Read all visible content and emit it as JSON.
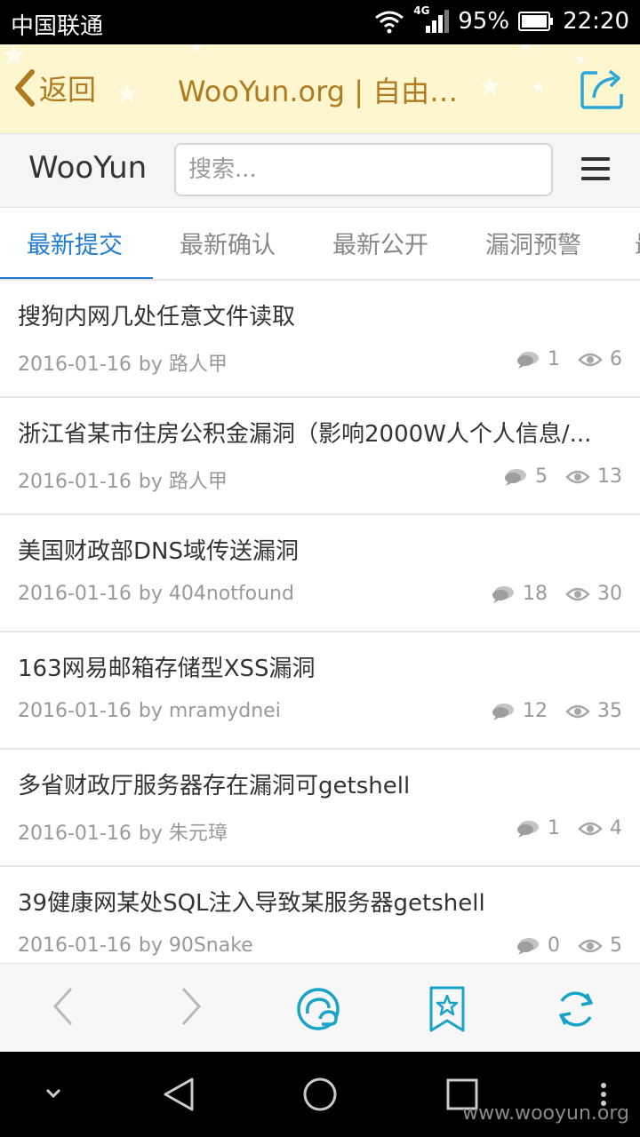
{
  "status_bar": {
    "carrier": "中国联通",
    "network": "4G",
    "battery": "95%",
    "time": "22:20"
  },
  "browser": {
    "back_label": "返回",
    "page_title": "WooYun.org | 自由平台",
    "share_icon": "share-icon"
  },
  "site_header": {
    "brand": "WooYun",
    "search_placeholder": "搜索...",
    "menu_icon": "hamburger-menu-icon"
  },
  "tabs": [
    {
      "label": "最新提交",
      "active": true
    },
    {
      "label": "最新确认",
      "active": false
    },
    {
      "label": "最新公开",
      "active": false
    },
    {
      "label": "漏洞预警",
      "active": false
    }
  ],
  "items": [
    {
      "title": "搜狗内网几处任意文件读取",
      "date": "2016-01-16",
      "author": "by 路人甲",
      "comments": "1",
      "views": "6"
    },
    {
      "title": "浙江省某市住房公积金漏洞（影响2000W人个人信息/...",
      "date": "2016-01-16",
      "author": "by 路人甲",
      "comments": "5",
      "views": "13"
    },
    {
      "title": "美国财政部DNS域传送漏洞",
      "date": "2016-01-16",
      "author": "by 404notfound",
      "comments": "18",
      "views": "30"
    },
    {
      "title": "163网易邮箱存储型XSS漏洞",
      "date": "2016-01-16",
      "author": "by mramydnei",
      "comments": "12",
      "views": "35"
    },
    {
      "title": "多省财政厅服务器存在漏洞可getshell",
      "date": "2016-01-16",
      "author": "by 朱元璋",
      "comments": "1",
      "views": "4"
    },
    {
      "title": "39健康网某处SQL注入导致某服务器getshell",
      "date": "2016-01-16",
      "author": "by 90Snake",
      "comments": "0",
      "views": "5"
    }
  ],
  "watermark": "www.wooyun.org",
  "colors": {
    "accent": "#1f7bd0",
    "browser_bar_bg": "#fdf6cf",
    "browser_text": "#b07a1e",
    "toolbar_icon": "#1aa3c8"
  }
}
